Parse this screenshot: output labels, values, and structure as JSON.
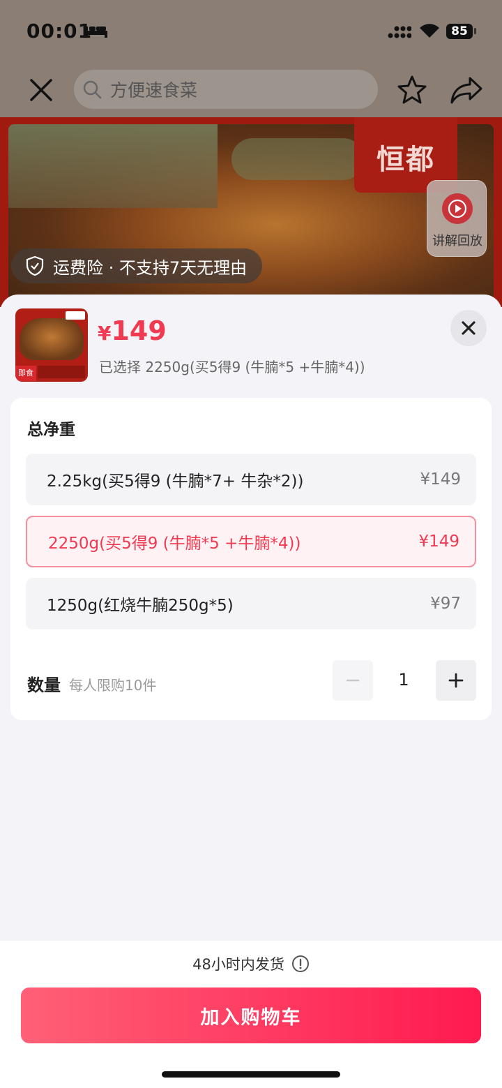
{
  "status_bar": {
    "time": "00:01",
    "battery": "85"
  },
  "search": {
    "placeholder": "方便速食菜"
  },
  "hero": {
    "brand_logo": "恒都",
    "replay_label": "讲解回放",
    "insurance_text": "运费险 · 不支持7天无理由"
  },
  "sheet": {
    "thumbnail_tag": "即食",
    "price_currency": "¥",
    "price_value": "149",
    "selected_text": "已选择 2250g(买5得9 (牛腩*5 +牛腩*4))",
    "group_title": "总净重",
    "options": [
      {
        "label": "2.25kg(买5得9 (牛腩*7+ 牛杂*2))",
        "price": "¥149",
        "selected": false
      },
      {
        "label": "2250g(买5得9 (牛腩*5 +牛腩*4))",
        "price": "¥149",
        "selected": true
      },
      {
        "label": "1250g(红烧牛腩250g*5)",
        "price": "¥97",
        "selected": false
      }
    ],
    "quantity_label": "数量",
    "quantity_limit": "每人限购10件",
    "quantity_value": "1"
  },
  "footer": {
    "shipping_text": "48小时内发货",
    "add_to_cart": "加入购物车"
  },
  "colors": {
    "accent": "#f03a52",
    "button_start": "#ff6077",
    "button_end": "#ff1a4f"
  }
}
